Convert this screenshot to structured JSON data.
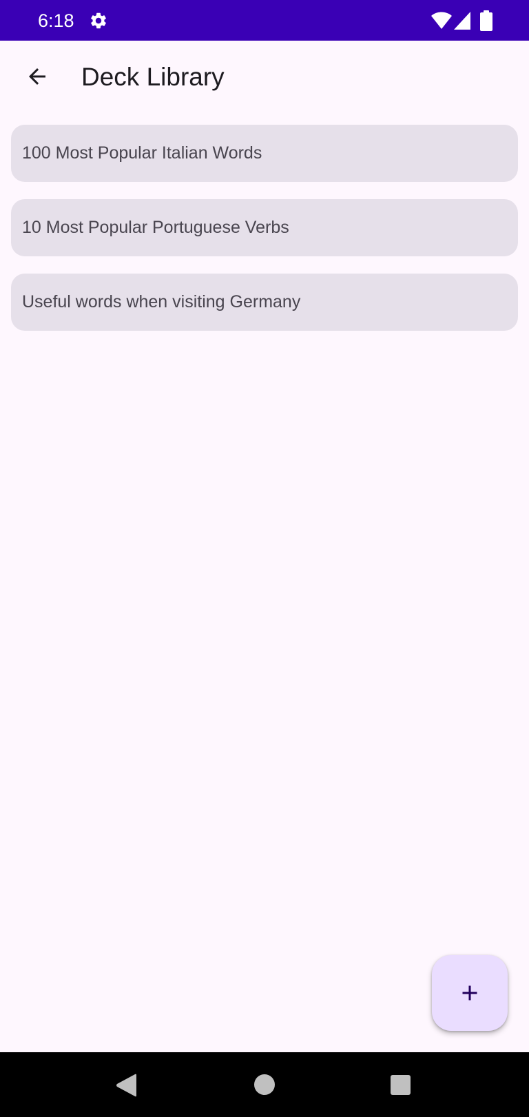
{
  "status_bar": {
    "time": "6:18",
    "icons": [
      "gear-icon",
      "wifi-icon",
      "cellular-signal-icon",
      "battery-icon"
    ],
    "background": "#3a00b5"
  },
  "app_bar": {
    "back_icon": "arrow-back-icon",
    "title": "Deck Library"
  },
  "decks": [
    {
      "label": "100 Most Popular Italian Words"
    },
    {
      "label": "10 Most Popular Portuguese Verbs"
    },
    {
      "label": "Useful words when visiting Germany"
    }
  ],
  "fab": {
    "icon": "plus-icon",
    "background": "#eaddff"
  },
  "nav_bar": {
    "icons": [
      "nav-back-icon",
      "nav-home-icon",
      "nav-recents-icon"
    ]
  },
  "colors": {
    "page_background": "#fef7fe",
    "card_background": "#e6e0ea",
    "accent": "#3a00b5"
  }
}
